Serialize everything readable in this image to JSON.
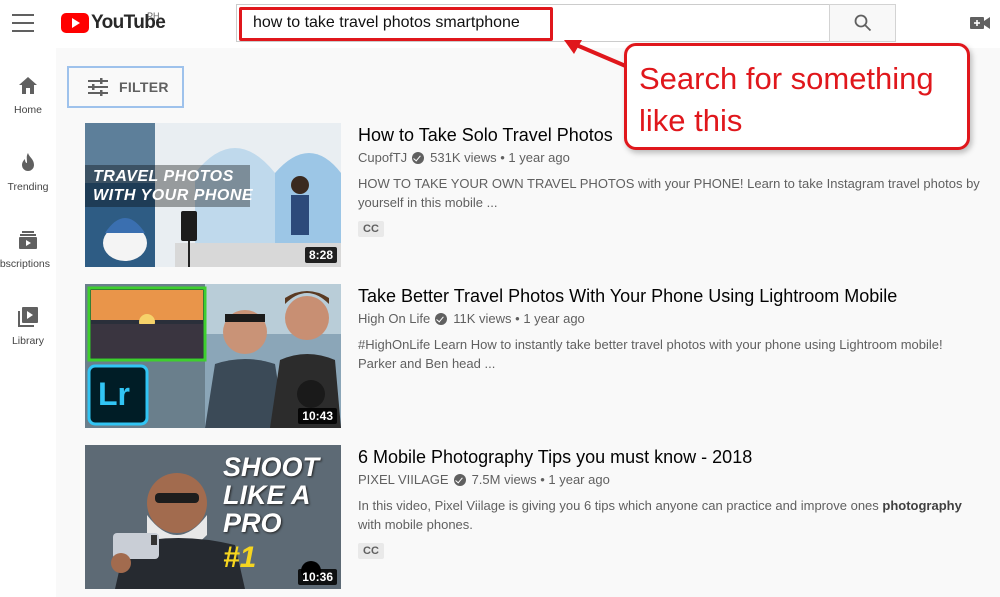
{
  "header": {
    "logo_text": "YouTube",
    "country": "PH",
    "search_value": "how to take travel photos smartphone"
  },
  "sidebar": {
    "items": [
      {
        "label": "Home",
        "icon": "home-icon"
      },
      {
        "label": "Trending",
        "icon": "flame-icon"
      },
      {
        "label": "ubscriptions",
        "icon": "subscriptions-icon"
      },
      {
        "label": "Library",
        "icon": "library-icon"
      }
    ]
  },
  "filter": {
    "label": "FILTER"
  },
  "callout": {
    "line1": "Search for something",
    "line2": "like this"
  },
  "results": [
    {
      "title": "How to Take Solo Travel Photos",
      "channel": "CupofTJ",
      "views": "531K views",
      "age": "1 year ago",
      "desc_line1": "HOW TO TAKE YOUR OWN TRAVEL PHOTOS with your PHONE! Learn to take Instagram travel photos by",
      "desc_line2": "yourself in this mobile ...",
      "duration": "8:28",
      "cc": "CC",
      "thumb_text1": "TRAVEL PHOTOS",
      "thumb_text2": "WITH YOUR PHONE"
    },
    {
      "title": "Take Better Travel Photos With Your Phone Using Lightroom Mobile",
      "channel": "High On Life",
      "views": "11K views",
      "age": "1 year ago",
      "desc_line1": "#HighOnLife Learn How to instantly take better travel photos with your phone using Lightroom mobile!",
      "desc_line2": "Parker and Ben head ...",
      "duration": "10:43",
      "thumb_text1": "Lr"
    },
    {
      "title": "6 Mobile Photography Tips you must know - 2018",
      "channel": "PIXEL VIILAGE",
      "views": "7.5M views",
      "age": "1 year ago",
      "desc_line1_a": "In this video, Pixel Viilage is giving you 6 tips which anyone can practice and improve ones ",
      "desc_line1_b": "photography",
      "desc_line2": "with mobile phones.",
      "duration": "10:36",
      "cc": "CC",
      "thumb_text1": "SHOOT",
      "thumb_text2": "LIKE A",
      "thumb_text3": "PRO",
      "thumb_text4": "#1"
    }
  ],
  "colors": {
    "accent_red": "#e0171c",
    "youtube_red": "#ff0000",
    "filter_border": "#9ec2ec"
  }
}
